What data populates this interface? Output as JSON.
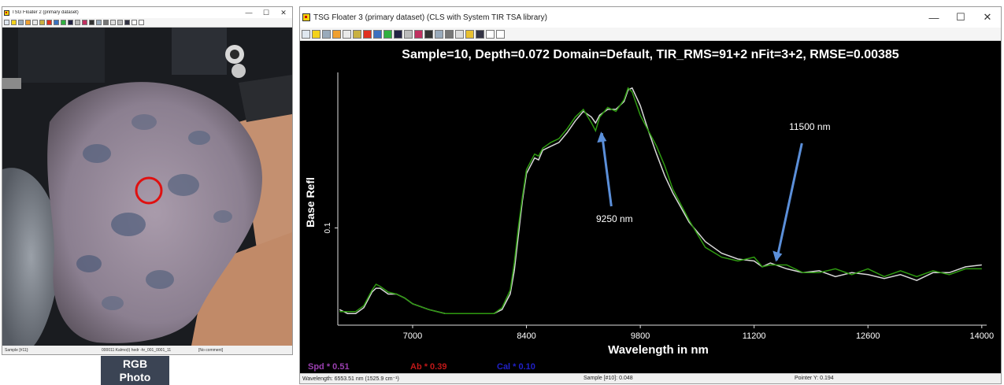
{
  "left_window": {
    "title": "TSG Floater 2 (primary dataset)",
    "status": {
      "sample": "Sample [#11]:",
      "file": "000011:Kalmo(i) hedr -hr_001_0001_11",
      "comment": "[No comment]"
    }
  },
  "rgb_label": {
    "line1": "RGB",
    "line2": "Photo"
  },
  "right_window": {
    "title": "TSG Floater 3 (primary dataset) (CLS with System TIR TSA  library)",
    "status": {
      "wavelength": "Wavelength: 6553.51 nm  (1525.9 cm⁻¹)",
      "sample": "Sample [#10]: 0.048",
      "pointer": "Pointer Y: 0.194"
    }
  },
  "window_controls": {
    "minimize": "—",
    "maximize": "☐",
    "close": "✕"
  },
  "colors": {
    "measured": "#d8d8d8",
    "fitted": "#2e9a10",
    "annotation_arrow": "#5b8fd9",
    "spd": "#9a3fb0",
    "ab": "#c01818",
    "cal": "#2020c8",
    "sample_marker": "#e01010"
  },
  "chart_data": {
    "type": "line",
    "title": "Sample=10, Depth=0.072      Domain=Default, TIR_RMS=91+2      nFit=3+2, RMSE=0.00385",
    "xlabel": "Wavelength in nm",
    "ylabel": "Base Refl",
    "xlim": [
      6080,
      14060
    ],
    "ylim": [
      0.05,
      0.18
    ],
    "xticks": [
      7000,
      8400,
      9800,
      11200,
      12600,
      14000
    ],
    "xtick_labels": [
      "7000",
      "8400",
      "9800",
      "11200",
      "12600",
      "14000"
    ],
    "yticks": [
      0.1
    ],
    "ytick_labels": [
      "0.1"
    ],
    "series": [
      {
        "key": "measured",
        "x": [
          6100,
          6200,
          6300,
          6400,
          6500,
          6550,
          6600,
          6700,
          6800,
          6900,
          7000,
          7200,
          7400,
          7600,
          7800,
          8000,
          8100,
          8200,
          8250,
          8300,
          8350,
          8400,
          8500,
          8550,
          8600,
          8700,
          8800,
          8900,
          9000,
          9100,
          9200,
          9250,
          9300,
          9400,
          9500,
          9600,
          9650,
          9700,
          9800,
          9900,
          10000,
          10100,
          10200,
          10400,
          10600,
          10800,
          11000,
          11200,
          11300,
          11400,
          11600,
          11800,
          12000,
          12200,
          12400,
          12600,
          12800,
          13000,
          13200,
          13400,
          13600,
          13800,
          14000
        ],
        "y": [
          0.058,
          0.056,
          0.056,
          0.059,
          0.067,
          0.069,
          0.069,
          0.066,
          0.066,
          0.064,
          0.061,
          0.058,
          0.056,
          0.056,
          0.056,
          0.056,
          0.058,
          0.066,
          0.078,
          0.096,
          0.114,
          0.128,
          0.136,
          0.135,
          0.14,
          0.142,
          0.144,
          0.149,
          0.155,
          0.16,
          0.157,
          0.154,
          0.158,
          0.161,
          0.161,
          0.165,
          0.171,
          0.172,
          0.163,
          0.15,
          0.138,
          0.127,
          0.118,
          0.103,
          0.093,
          0.087,
          0.084,
          0.083,
          0.08,
          0.082,
          0.079,
          0.077,
          0.078,
          0.075,
          0.077,
          0.076,
          0.074,
          0.076,
          0.073,
          0.077,
          0.077,
          0.08,
          0.081
        ]
      },
      {
        "key": "fitted",
        "x": [
          6100,
          6200,
          6300,
          6400,
          6500,
          6550,
          6600,
          6700,
          6800,
          6900,
          7000,
          7200,
          7400,
          7600,
          7800,
          8000,
          8100,
          8200,
          8250,
          8300,
          8350,
          8400,
          8500,
          8550,
          8600,
          8700,
          8800,
          8900,
          9000,
          9100,
          9200,
          9250,
          9300,
          9400,
          9500,
          9600,
          9650,
          9700,
          9800,
          9900,
          10000,
          10100,
          10200,
          10400,
          10600,
          10800,
          11000,
          11200,
          11300,
          11400,
          11600,
          11800,
          12000,
          12200,
          12400,
          12600,
          12800,
          13000,
          13200,
          13400,
          13600,
          13800,
          14000
        ],
        "y": [
          0.057,
          0.057,
          0.057,
          0.06,
          0.068,
          0.071,
          0.07,
          0.067,
          0.066,
          0.064,
          0.061,
          0.058,
          0.056,
          0.056,
          0.056,
          0.056,
          0.059,
          0.068,
          0.082,
          0.1,
          0.116,
          0.13,
          0.138,
          0.137,
          0.141,
          0.144,
          0.146,
          0.151,
          0.157,
          0.161,
          0.154,
          0.15,
          0.157,
          0.162,
          0.16,
          0.166,
          0.172,
          0.17,
          0.158,
          0.15,
          0.142,
          0.132,
          0.12,
          0.104,
          0.09,
          0.085,
          0.083,
          0.085,
          0.08,
          0.081,
          0.081,
          0.077,
          0.077,
          0.079,
          0.076,
          0.079,
          0.075,
          0.078,
          0.075,
          0.078,
          0.076,
          0.079,
          0.079
        ]
      }
    ],
    "annotations": [
      {
        "text": "9250 nm",
        "x": 9250,
        "y": 0.152
      },
      {
        "text": "11500 nm",
        "x": 11400,
        "y": 0.081
      }
    ],
    "legend": [
      {
        "key": "spd",
        "text": "Spd * 0.51"
      },
      {
        "key": "ab",
        "text": "Ab * 0.39"
      },
      {
        "key": "cal",
        "text": "Cal * 0.10"
      }
    ]
  }
}
